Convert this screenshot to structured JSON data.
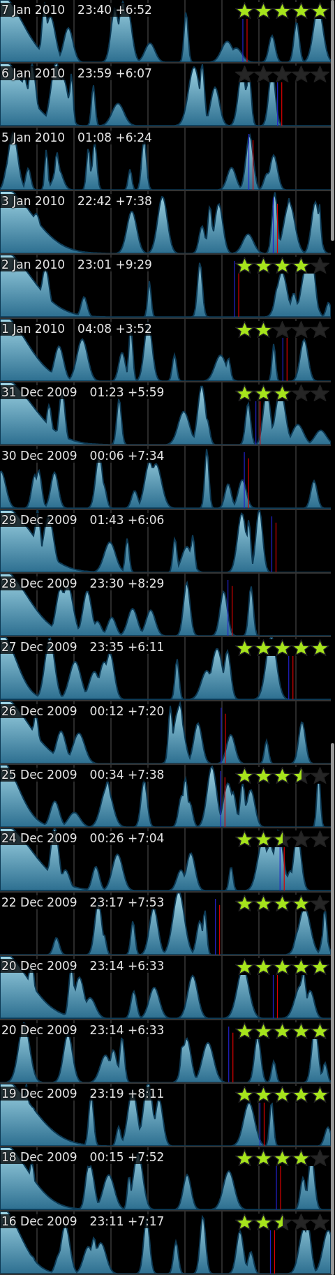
{
  "nights": [
    {
      "date": "7 Jan 2010",
      "start": "23:40",
      "duration": "+6:52",
      "stars": 5
    },
    {
      "date": "6 Jan 2010",
      "start": "23:59",
      "duration": "+6:07",
      "stars": 0
    },
    {
      "date": "5 Jan 2010",
      "start": "01:08",
      "duration": "+6:24"
    },
    {
      "date": "3 Jan 2010",
      "start": "22:42",
      "duration": "+7:38"
    },
    {
      "date": "2 Jan 2010",
      "start": "23:01",
      "duration": "+9:29",
      "stars": 4
    },
    {
      "date": "1 Jan 2010",
      "start": "04:08",
      "duration": "+3:52",
      "stars": 2
    },
    {
      "date": "31 Dec 2009",
      "start": "01:23",
      "duration": "+5:59",
      "stars": 3
    },
    {
      "date": "30 Dec 2009",
      "start": "00:06",
      "duration": "+7:34"
    },
    {
      "date": "29 Dec 2009",
      "start": "01:43",
      "duration": "+6:06"
    },
    {
      "date": "28 Dec 2009",
      "start": "23:30",
      "duration": "+8:29"
    },
    {
      "date": "27 Dec 2009",
      "start": "23:35",
      "duration": "+6:11",
      "stars": 5
    },
    {
      "date": "26 Dec 2009",
      "start": "00:12",
      "duration": "+7:20"
    },
    {
      "date": "25 Dec 2009",
      "start": "00:34",
      "duration": "+7:38",
      "stars": 3.5
    },
    {
      "date": "24 Dec 2009",
      "start": "00:26",
      "duration": "+7:04",
      "stars": 2.5
    },
    {
      "date": "22 Dec 2009",
      "start": "23:17",
      "duration": "+7:53",
      "stars": 4
    },
    {
      "date": "20 Dec 2009",
      "start": "23:14",
      "duration": "+6:33",
      "stars": 5
    },
    {
      "date": "20 Dec 2009",
      "start": "23:14",
      "duration": "+6:33",
      "stars": 5
    },
    {
      "date": "19 Dec 2009",
      "start": "23:19",
      "duration": "+8:11",
      "stars": 5
    },
    {
      "date": "18 Dec 2009",
      "start": "00:15",
      "duration": "+7:52",
      "stars": 4
    },
    {
      "date": "16 Dec 2009",
      "start": "23:11",
      "duration": "+7:17",
      "stars": 2.5
    }
  ]
}
